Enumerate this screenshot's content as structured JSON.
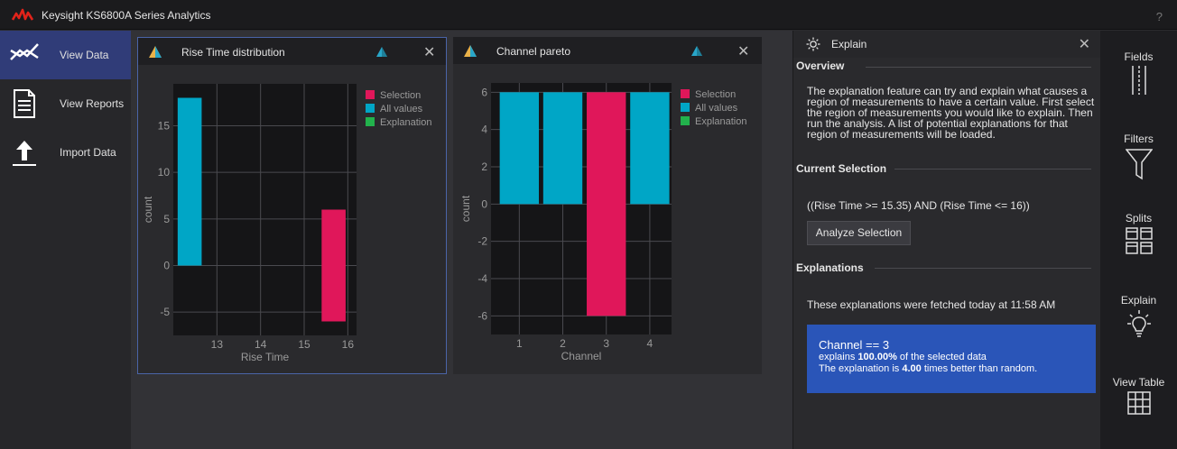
{
  "app": {
    "title": "Keysight KS6800A Series Analytics",
    "help": "?"
  },
  "colors": {
    "selection": "#e0175a",
    "all_values": "#00a6c6",
    "explanation": "#22b24c",
    "accent": "#303c78"
  },
  "nav": [
    {
      "label": "View Data",
      "icon": "chart-line-icon",
      "active": true
    },
    {
      "label": "View Reports",
      "icon": "document-icon",
      "active": false
    },
    {
      "label": "Import Data",
      "icon": "upload-icon",
      "active": false
    }
  ],
  "panels": {
    "rise": {
      "title": "Rise Time distribution"
    },
    "pareto": {
      "title": "Channel pareto"
    }
  },
  "explain": {
    "title": "Explain",
    "overview_h": "Overview",
    "overview_lines": [
      "The explanation feature can try and explain what causes a",
      "region of measurements to have a certain value. First select",
      "the region of measurements you would like to explain. Then",
      "run the analysis. A list of potential explanations for that",
      "region of measurements will be loaded."
    ],
    "current_h": "Current Selection",
    "selection": "((Rise Time >= 15.35) AND (Rise Time <= 16))",
    "analyze_btn": "Analyze Selection",
    "explanations_h": "Explanations",
    "fetched": "These explanations were fetched today at 11:58 AM",
    "card": {
      "title": "Channel == 3",
      "l2_pre": "explains ",
      "l2_bold": "100.00%",
      "l2_post": " of the selected data",
      "l3_pre": "The explanation is ",
      "l3_bold": "4.00",
      "l3_post": " times better than random."
    }
  },
  "rightbar": [
    {
      "label": "Fields",
      "icon": "fields-icon"
    },
    {
      "label": "Filters",
      "icon": "filter-icon"
    },
    {
      "label": "Splits",
      "icon": "splits-icon"
    },
    {
      "label": "Explain",
      "icon": "lightbulb-icon"
    },
    {
      "label": "View Table",
      "icon": "table-icon"
    }
  ],
  "chart_data": [
    {
      "type": "bar",
      "title": "Rise Time distribution",
      "xlabel": "Rise Time",
      "ylabel": "count",
      "xlim": [
        12,
        16.2
      ],
      "ylim": [
        -7.5,
        19.5
      ],
      "xticks": [
        13,
        14,
        15,
        16
      ],
      "yticks": [
        -5,
        0,
        5,
        10,
        15
      ],
      "legend": [
        "Selection",
        "All values",
        "Explanation"
      ],
      "legend_position": "top-right",
      "bars": [
        {
          "series": "All values",
          "x0": 12.1,
          "x1": 12.65,
          "y0": 0,
          "y1": 18
        },
        {
          "series": "Selection",
          "x0": 15.4,
          "x1": 15.95,
          "y0": -6,
          "y1": 6
        }
      ]
    },
    {
      "type": "bar",
      "title": "Channel pareto",
      "xlabel": "Channel",
      "ylabel": "count",
      "xlim": [
        0.35,
        4.5
      ],
      "ylim": [
        -7,
        6.5
      ],
      "xticks": [
        1,
        2,
        3,
        4
      ],
      "yticks": [
        -6,
        -4,
        -2,
        0,
        2,
        4,
        6
      ],
      "legend": [
        "Selection",
        "All values",
        "Explanation"
      ],
      "legend_position": "top-right",
      "bars": [
        {
          "series": "All values",
          "x0": 0.55,
          "x1": 1.45,
          "y0": 0,
          "y1": 6
        },
        {
          "series": "All values",
          "x0": 1.55,
          "x1": 2.45,
          "y0": 0,
          "y1": 6
        },
        {
          "series": "Selection",
          "x0": 2.55,
          "x1": 3.45,
          "y0": -6,
          "y1": 6
        },
        {
          "series": "All values",
          "x0": 3.55,
          "x1": 4.45,
          "y0": 0,
          "y1": 6
        }
      ]
    }
  ]
}
